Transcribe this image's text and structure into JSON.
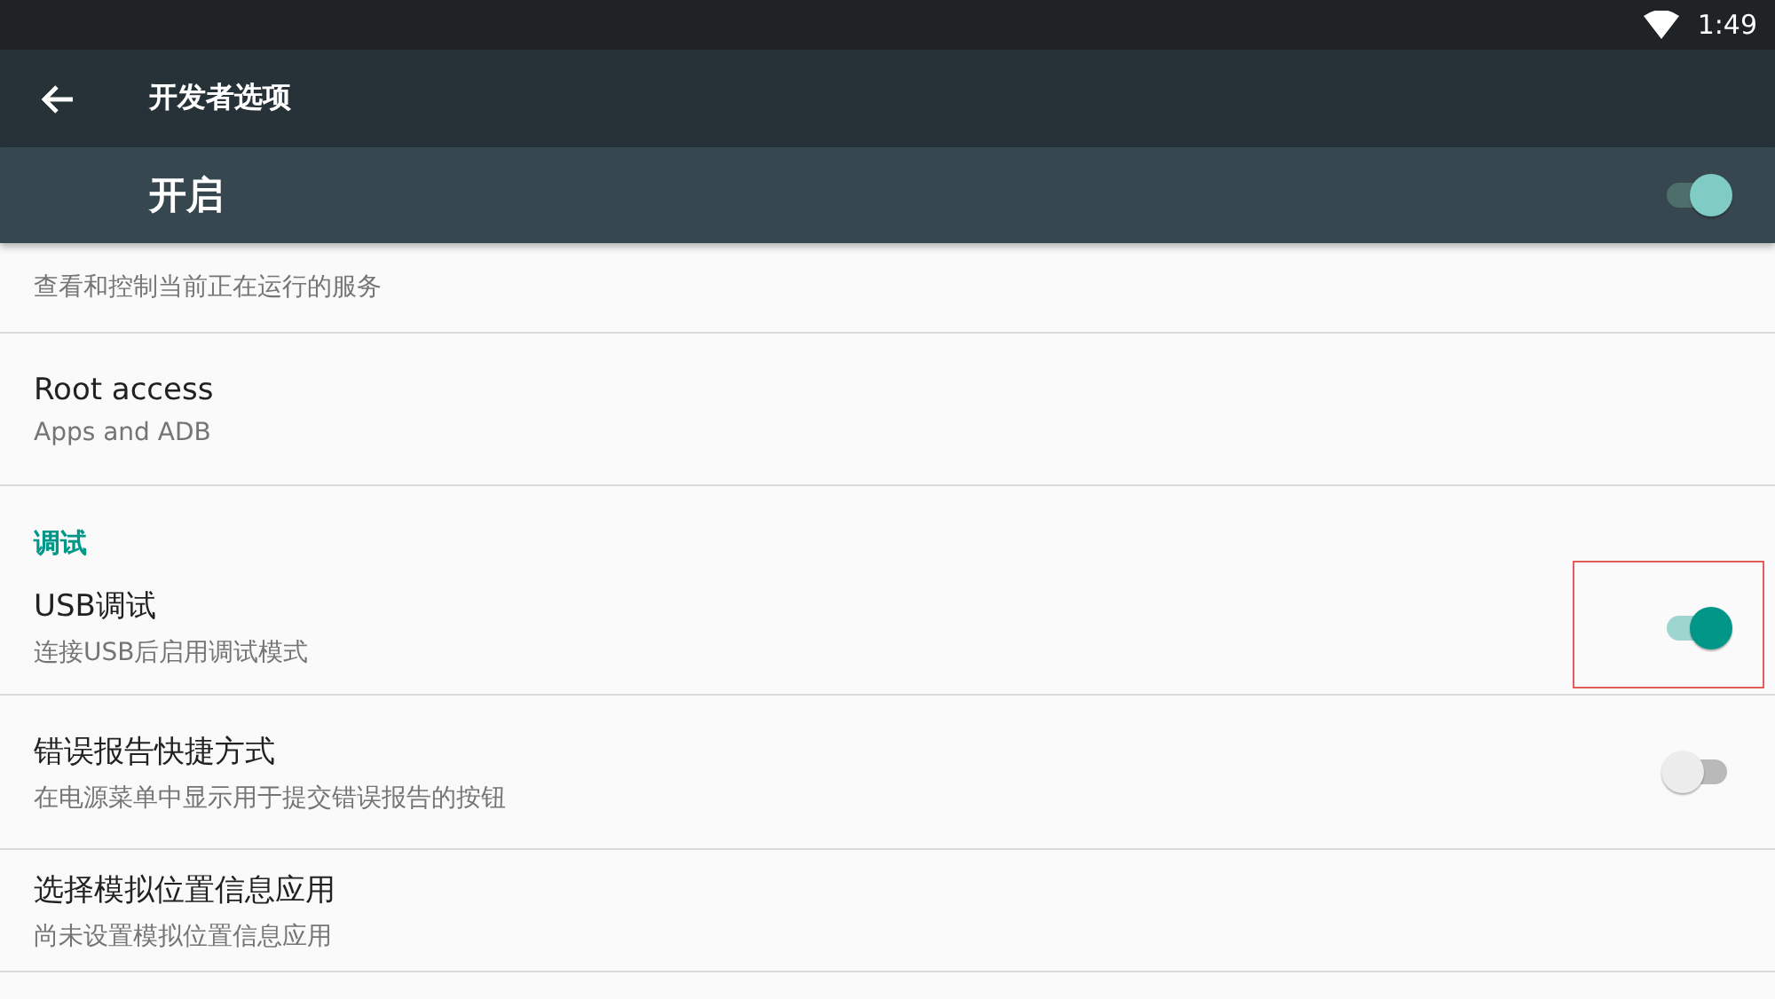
{
  "status_bar": {
    "time": "1:49"
  },
  "app_bar": {
    "title": "开发者选项"
  },
  "master_switch": {
    "label": "开启",
    "on": true
  },
  "sections": [
    {
      "items": [
        {
          "subtitle": "查看和控制当前正在运行的服务",
          "kind": "plain"
        },
        {
          "title": "Root access",
          "subtitle": "Apps and ADB",
          "kind": "plain"
        }
      ]
    },
    {
      "header": "调试",
      "items": [
        {
          "title": "USB调试",
          "subtitle": "连接USB后启用调试模式",
          "kind": "switch",
          "on": true,
          "highlighted": true
        },
        {
          "title": "错误报告快捷方式",
          "subtitle": "在电源菜单中显示用于提交错误报告的按钮",
          "kind": "switch",
          "on": false,
          "highlighted": false
        },
        {
          "title": "选择模拟位置信息应用",
          "subtitle": "尚未设置模拟位置信息应用",
          "kind": "plain"
        }
      ]
    }
  ]
}
